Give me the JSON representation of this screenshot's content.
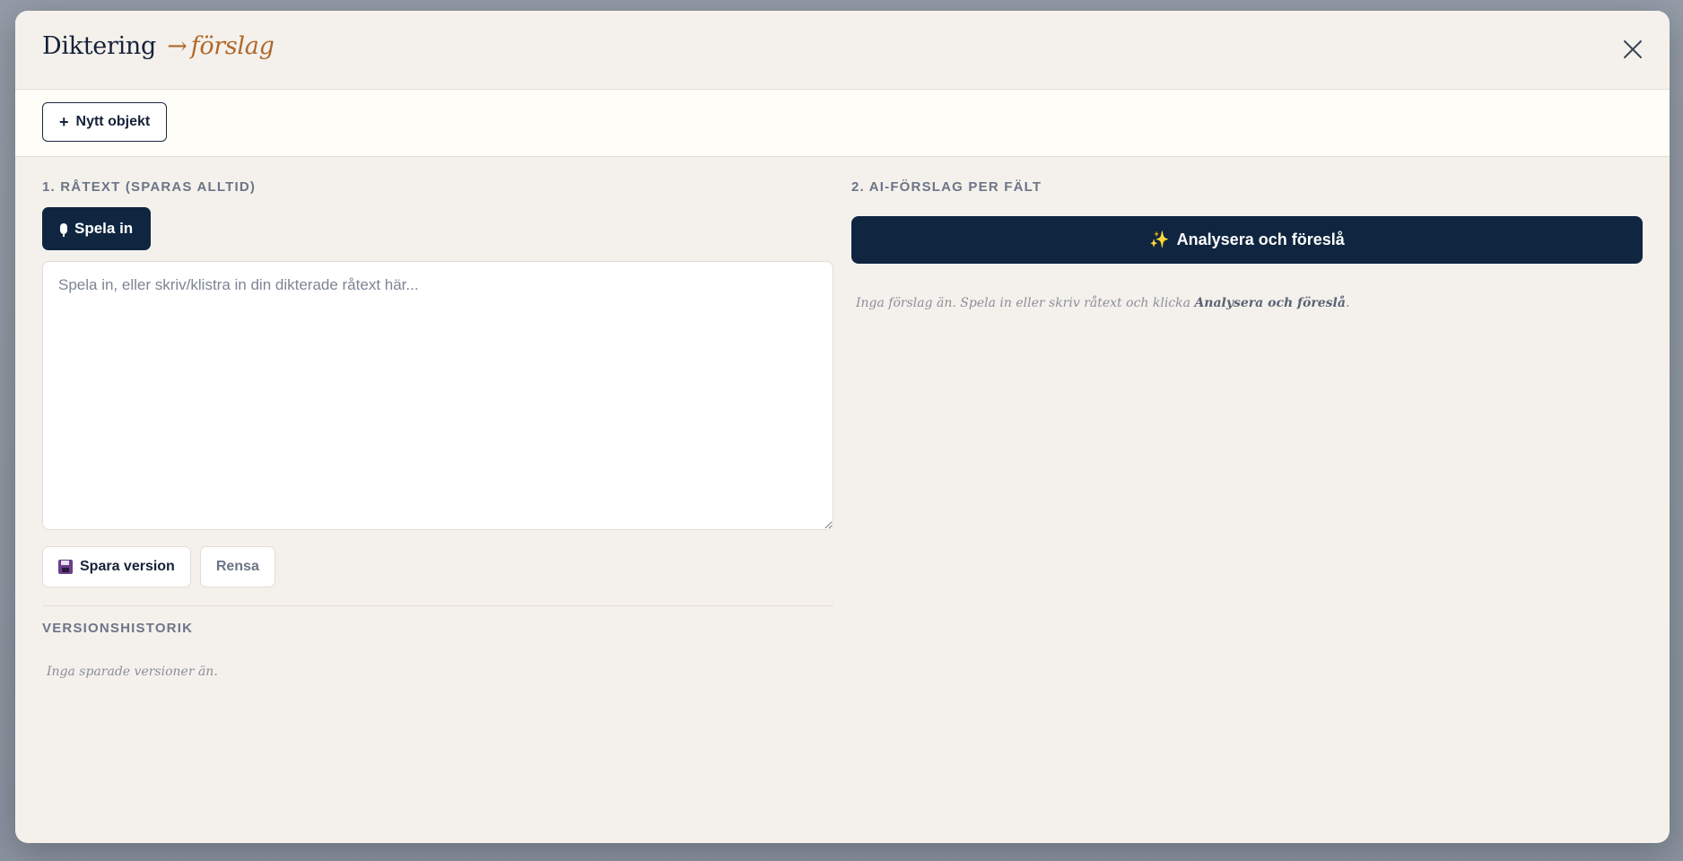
{
  "modal": {
    "title_main": "Diktering",
    "title_arrow": "→",
    "title_accent": "förslag",
    "close_icon": "close-icon"
  },
  "toolbar": {
    "new_object_label": "Nytt objekt",
    "new_object_icon": "plus-icon"
  },
  "raw_text": {
    "section_label": "1. RÅTEXT (SPARAS ALLTID)",
    "record_label": "Spela in",
    "record_icon": "microphone-icon",
    "placeholder": "Spela in, eller skriv/klistra in din dikterade råtext här...",
    "value": "",
    "save_label": "Spara version",
    "save_icon": "floppy-disk-icon",
    "clear_label": "Rensa",
    "history_label": "VERSIONSHISTORIK",
    "history_empty": "Inga sparade versioner än."
  },
  "suggestions": {
    "section_label": "2. AI-FÖRSLAG PER FÄLT",
    "analyze_label": "Analysera och föreslå",
    "analyze_icon": "sparkles-icon",
    "empty_prefix": "Inga förslag än. Spela in eller skriv råtext och klicka ",
    "empty_action": "Analysera och föreslå",
    "empty_suffix": "."
  },
  "colors": {
    "primary": "#0f2540",
    "accent": "#b0682a",
    "background": "#f4f1ec",
    "muted_text": "#6b7587"
  }
}
